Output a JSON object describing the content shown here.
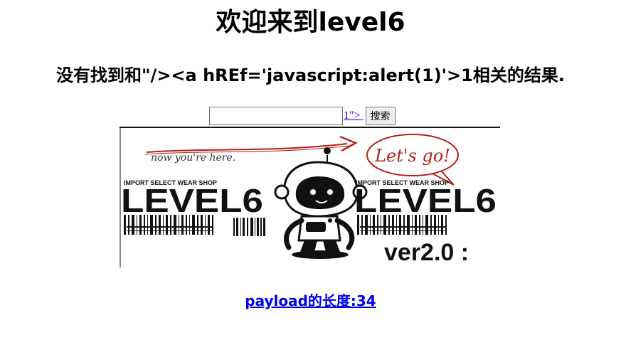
{
  "page": {
    "title": "欢迎来到level6",
    "result_text": "没有找到和\"/><a hREf='javascript:alert(1)'>1相关的结果."
  },
  "search": {
    "input_value": "",
    "injected_link_text": "1\"> ",
    "button_label": "搜索"
  },
  "banner": {
    "annotation": "now you're here.",
    "bubble_text": "Let's go!",
    "shop_name": "IMPORT SELECT WEAR SHOP",
    "brand": "LEVEL6",
    "version": "ver2.0 :",
    "accent_color": "#b3211b"
  },
  "footer": {
    "payload_length": "payload的长度:34"
  }
}
